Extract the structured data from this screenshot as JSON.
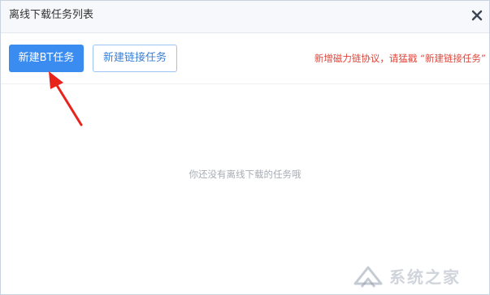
{
  "dialog": {
    "title": "离线下载任务列表",
    "close_icon": "close-icon"
  },
  "toolbar": {
    "new_bt_task_label": "新建BT任务",
    "new_link_task_label": "新建链接任务",
    "promo_text": "新增磁力链协议，请猛戳 “新建链接任务”"
  },
  "main": {
    "empty_message": "你还没有离线下载的任务哦"
  },
  "annotation": {
    "arrow_icon": "red-arrow-icon",
    "arrow_color": "#e8231c"
  },
  "watermark": {
    "text": "系统之家"
  },
  "colors": {
    "primary": "#3b8cf0",
    "promo": "#e0443a",
    "muted": "#a8adb5"
  }
}
